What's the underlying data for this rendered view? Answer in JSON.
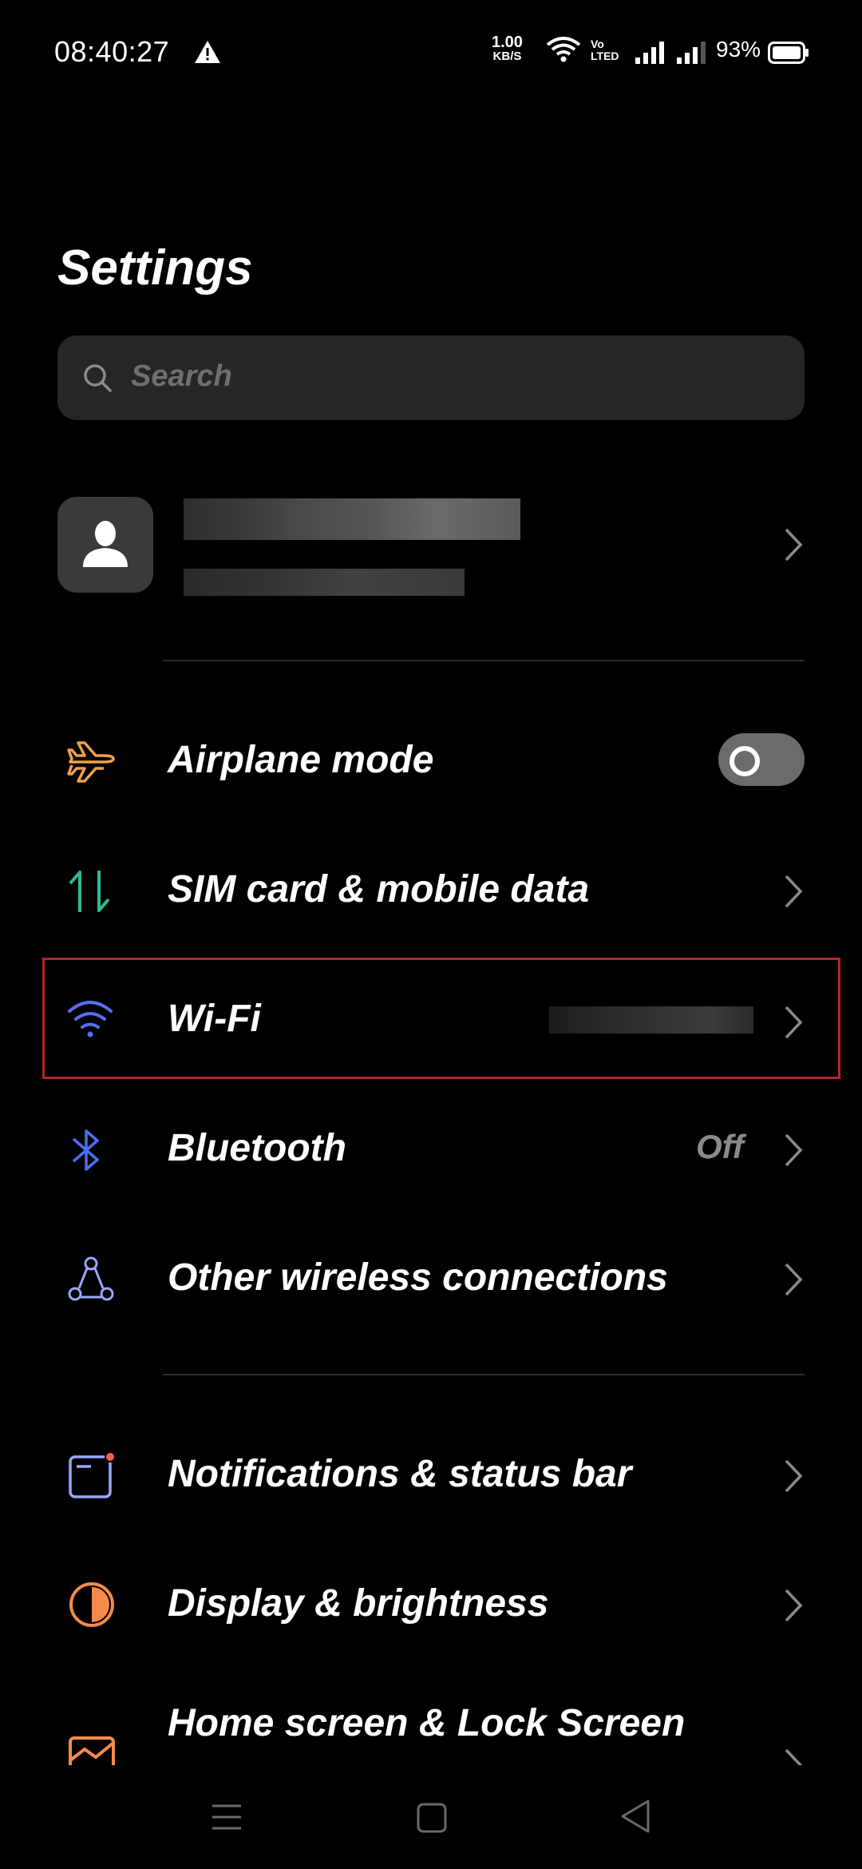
{
  "status_bar": {
    "time": "08:40:27",
    "net_speed_value": "1.00",
    "net_speed_unit": "KB/S",
    "volte_top": "Vo",
    "volte_bottom": "LTED",
    "battery_percent": "93%"
  },
  "header": {
    "title": "Settings"
  },
  "search": {
    "placeholder": "Search"
  },
  "settings_items": [
    {
      "label": "Airplane mode",
      "icon": "airplane-icon",
      "control": "toggle",
      "toggle_on": false
    },
    {
      "label": "SIM card & mobile data",
      "icon": "sim-data-icon"
    },
    {
      "label": "Wi-Fi",
      "icon": "wifi-icon",
      "highlighted": true
    },
    {
      "label": "Bluetooth",
      "icon": "bluetooth-icon",
      "value": "Off"
    },
    {
      "label": "Other wireless connections",
      "icon": "wireless-connections-icon"
    },
    {
      "label": "Notifications & status bar",
      "icon": "notifications-icon"
    },
    {
      "label": "Display & brightness",
      "icon": "display-brightness-icon"
    },
    {
      "label": "Home screen & Lock Screen",
      "icon": "home-lock-screen-icon"
    }
  ],
  "colors": {
    "background": "#000000",
    "search_bg": "#262626",
    "highlight_border": "#b5242a",
    "airplane_icon": "#f0a04b",
    "sim_icon": "#2fb89a",
    "wifi_icon": "#5b6cf0",
    "bluetooth_icon": "#4d6ff0"
  }
}
